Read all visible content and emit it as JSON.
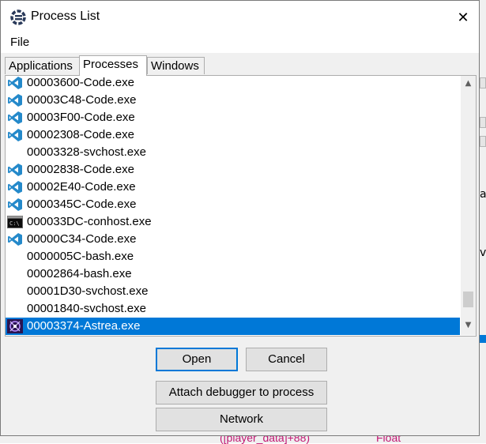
{
  "dialog": {
    "title": "Process List",
    "close_glyph": "✕",
    "menu": [
      "File"
    ],
    "tabs": [
      {
        "label": "Applications",
        "active": false
      },
      {
        "label": "Processes",
        "active": true
      },
      {
        "label": "Windows",
        "active": false
      }
    ],
    "processes": [
      {
        "name": "00003600-Code.exe",
        "icon": "vscode-icon"
      },
      {
        "name": "00003C48-Code.exe",
        "icon": "vscode-icon"
      },
      {
        "name": "00003F00-Code.exe",
        "icon": "vscode-icon"
      },
      {
        "name": "00002308-Code.exe",
        "icon": "vscode-icon"
      },
      {
        "name": "00003328-svchost.exe",
        "icon": ""
      },
      {
        "name": "00002838-Code.exe",
        "icon": "vscode-icon"
      },
      {
        "name": "00002E40-Code.exe",
        "icon": "vscode-icon"
      },
      {
        "name": "0000345C-Code.exe",
        "icon": "vscode-icon"
      },
      {
        "name": "000033DC-conhost.exe",
        "icon": "console-icon"
      },
      {
        "name": "00000C34-Code.exe",
        "icon": "vscode-icon"
      },
      {
        "name": "0000005C-bash.exe",
        "icon": ""
      },
      {
        "name": "00002864-bash.exe",
        "icon": ""
      },
      {
        "name": "00001D30-svchost.exe",
        "icon": ""
      },
      {
        "name": "00001840-svchost.exe",
        "icon": ""
      },
      {
        "name": "00003374-Astrea.exe",
        "icon": "astrea-icon",
        "selected": true
      }
    ],
    "buttons": {
      "open": "Open",
      "cancel": "Cancel",
      "attach": "Attach debugger to process",
      "network": "Network"
    }
  },
  "background": {
    "bottom_left_text": "([player_data]+88)",
    "bottom_right_text": "Float",
    "right_fragments": [
      "al",
      "vh"
    ]
  },
  "colors": {
    "selection": "#0078d7",
    "vscode_blue": "#2489ca",
    "bg_text_pink": "#c21874"
  }
}
